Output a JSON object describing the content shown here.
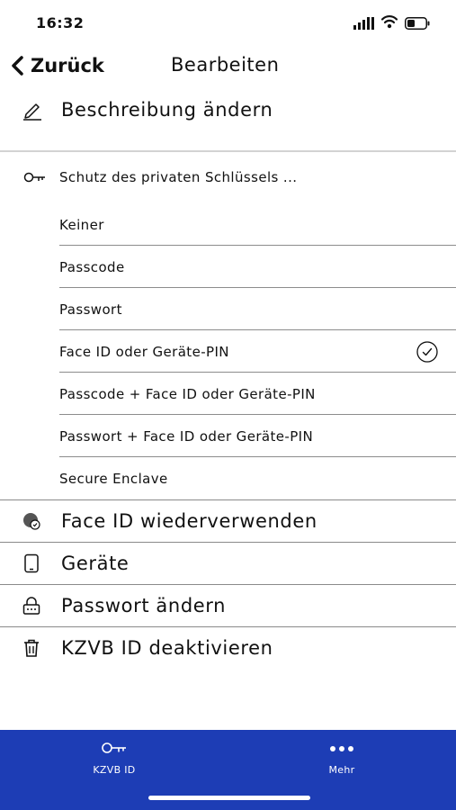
{
  "status_bar": {
    "time": "16:32"
  },
  "nav": {
    "back_label": "Zurück",
    "title": "Bearbeiten"
  },
  "edit_description": {
    "label": "Beschreibung ändern",
    "icon": "pencil-icon"
  },
  "key_protection": {
    "heading": "Schutz des privaten Schlüssels ...",
    "icon": "key-icon",
    "options": [
      {
        "label": "Keiner",
        "selected": false
      },
      {
        "label": "Passcode",
        "selected": false
      },
      {
        "label": "Passwort",
        "selected": false
      },
      {
        "label": "Face ID oder Geräte-PIN",
        "selected": true
      },
      {
        "label": "Passcode + Face ID oder Geräte-PIN",
        "selected": false
      },
      {
        "label": "Passwort + Face ID oder Geräte-PIN",
        "selected": false
      },
      {
        "label": "Secure Enclave",
        "selected": false
      }
    ]
  },
  "menu": [
    {
      "label": "Face ID wiederverwenden",
      "icon": "face-id-icon"
    },
    {
      "label": "Geräte",
      "icon": "phone-icon"
    },
    {
      "label": "Passwort ändern",
      "icon": "lock-icon"
    },
    {
      "label": "KZVB ID deaktivieren",
      "icon": "trash-icon"
    }
  ],
  "tab_bar": {
    "tabs": [
      {
        "label": "KZVB ID",
        "icon": "key-icon"
      },
      {
        "label": "Mehr",
        "icon": "more-dots-icon"
      }
    ]
  },
  "colors": {
    "tab_bar_bg": "#1d3db5",
    "tab_text": "#ffffff",
    "divider": "#8a8a8a"
  }
}
